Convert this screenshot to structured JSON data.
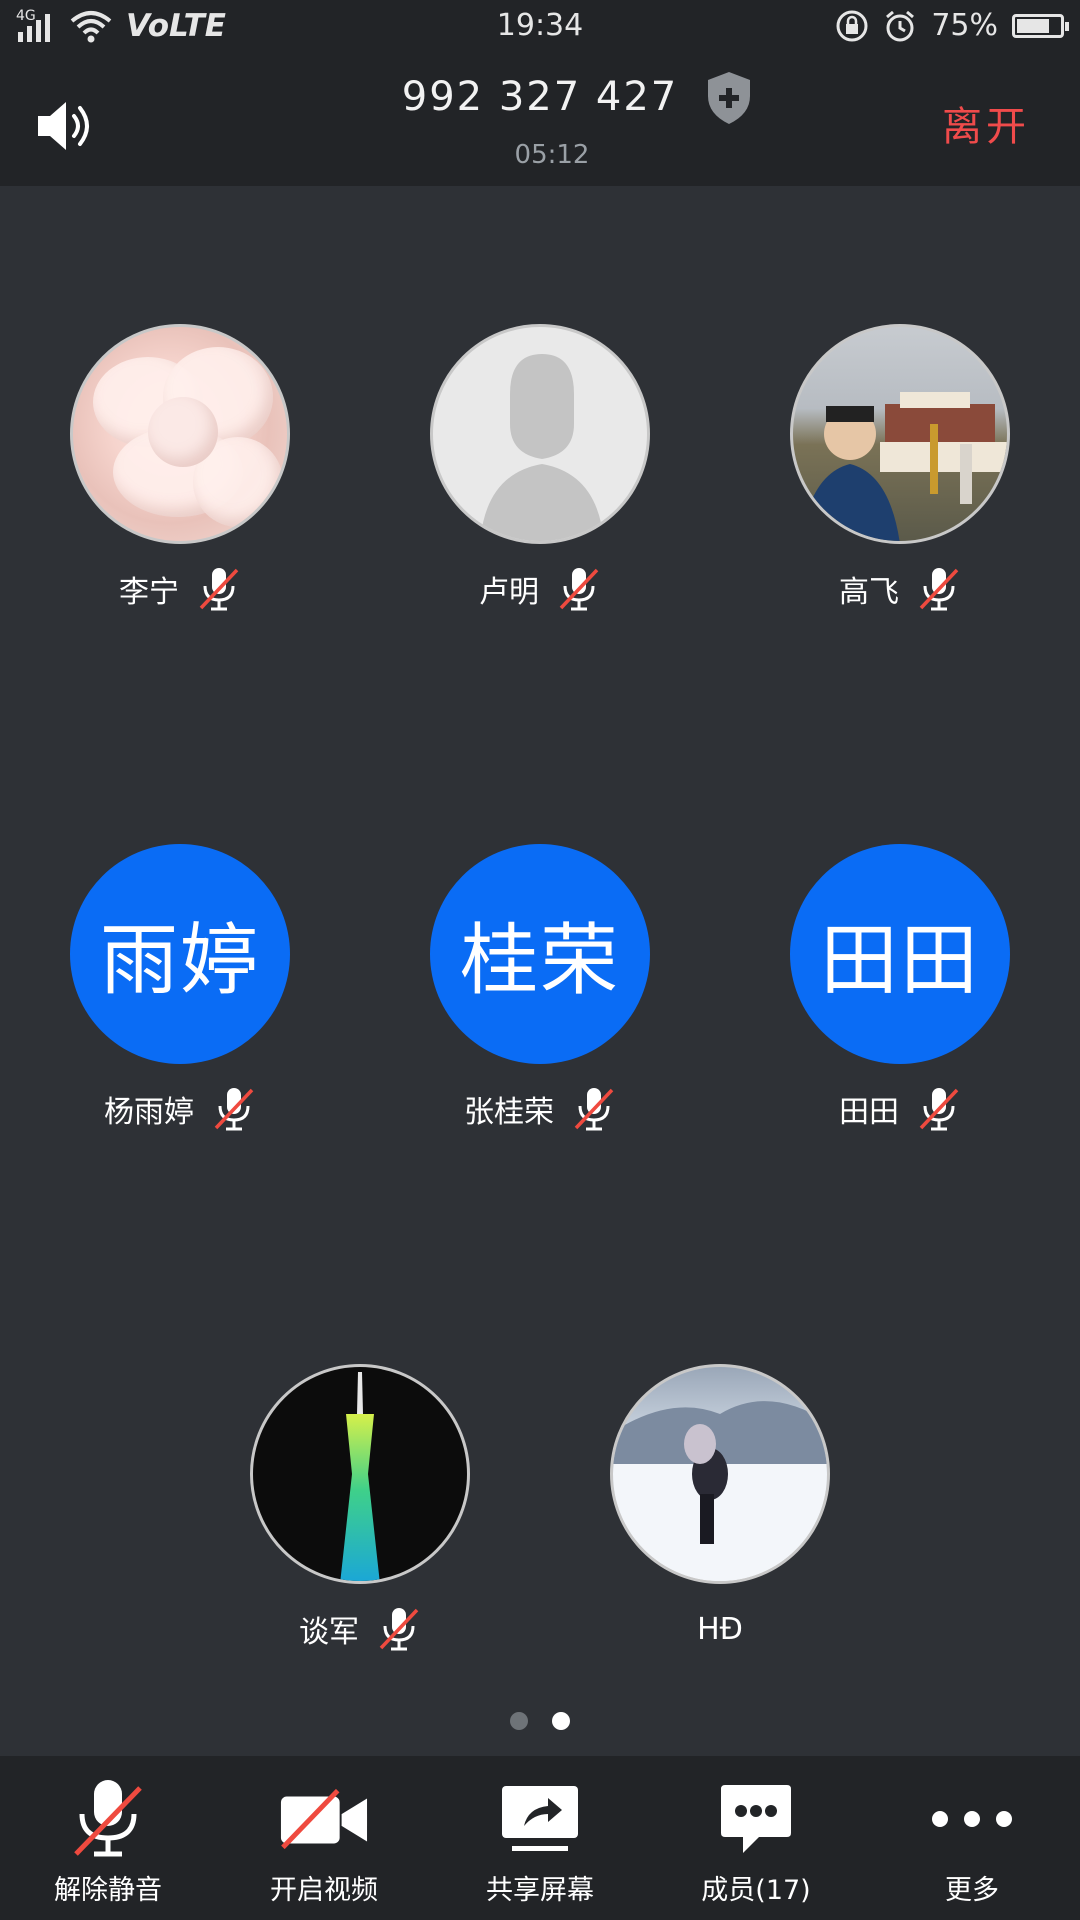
{
  "status_bar": {
    "network": "4G",
    "volte": "VoLTE",
    "time": "19:34",
    "battery": "75%",
    "battery_level": 0.75
  },
  "header": {
    "meeting_id": "992 327 427",
    "elapsed": "05:12",
    "leave_label": "离开"
  },
  "participants": [
    {
      "name": "李宁",
      "avatar": "photo-flower",
      "muted": true
    },
    {
      "name": "卢明",
      "avatar": "default-silhouette",
      "muted": true
    },
    {
      "name": "高飞",
      "avatar": "photo-potala",
      "muted": true
    },
    {
      "name": "杨雨婷",
      "avatar_text": "雨婷",
      "muted": true
    },
    {
      "name": "张桂荣",
      "avatar_text": "桂荣",
      "muted": true
    },
    {
      "name": "田田",
      "avatar_text": "田田",
      "muted": true
    },
    {
      "name": "谈军",
      "avatar": "photo-tower",
      "muted": true
    },
    {
      "name": "HĐ",
      "avatar": "photo-snow",
      "muted": false
    }
  ],
  "pagination": {
    "pages": 2,
    "current": 2
  },
  "toolbar": {
    "unmute_label": "解除静音",
    "video_label": "开启视频",
    "share_label": "共享屏幕",
    "members_label": "成员(17)",
    "more_label": "更多"
  },
  "colors": {
    "background": "#2e3136",
    "bar": "#222427",
    "accent_blue": "#0a6cf5",
    "leave_red": "#f04b4b",
    "mute_slash": "#ef4a3f"
  }
}
